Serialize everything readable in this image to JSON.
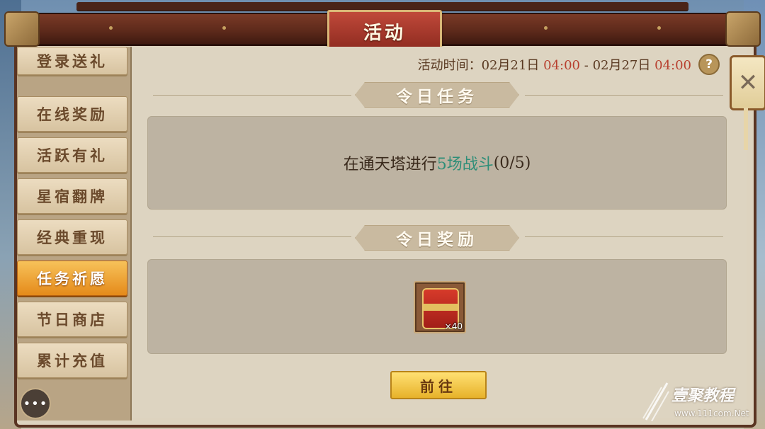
{
  "window": {
    "title": "活动"
  },
  "sidebar": {
    "items": [
      {
        "label": "登录送礼",
        "active": false
      },
      {
        "label": "在线奖励",
        "active": false
      },
      {
        "label": "活跃有礼",
        "active": false
      },
      {
        "label": "星宿翻牌",
        "active": false
      },
      {
        "label": "经典重现",
        "active": false
      },
      {
        "label": "任务祈愿",
        "active": true
      },
      {
        "label": "节日商店",
        "active": false
      },
      {
        "label": "累计充值",
        "active": false
      }
    ],
    "chat_icon": "chat-bubble-icon"
  },
  "activity_time": {
    "label": "活动时间：",
    "start_date": "02月21日",
    "start_time": "04:00",
    "separator": "-",
    "end_date": "02月27日",
    "end_time": "04:00"
  },
  "help": {
    "label": "?"
  },
  "today_task": {
    "title": "令日任务",
    "text_before": "在通天塔进行",
    "highlight": "5场战斗",
    "progress": "(0/5)"
  },
  "today_reward": {
    "title": "令日奖励",
    "item": {
      "icon": "red-scroll-icon",
      "count": "×40"
    }
  },
  "go_button": {
    "label": "前往"
  },
  "close": {
    "label": "✕"
  },
  "watermark": {
    "title": "壹聚教程",
    "url": "www.111com.Net"
  },
  "colors": {
    "highlight": "#2e8e78",
    "time_red": "#b8402f",
    "active_tab": "#e58a1a"
  }
}
